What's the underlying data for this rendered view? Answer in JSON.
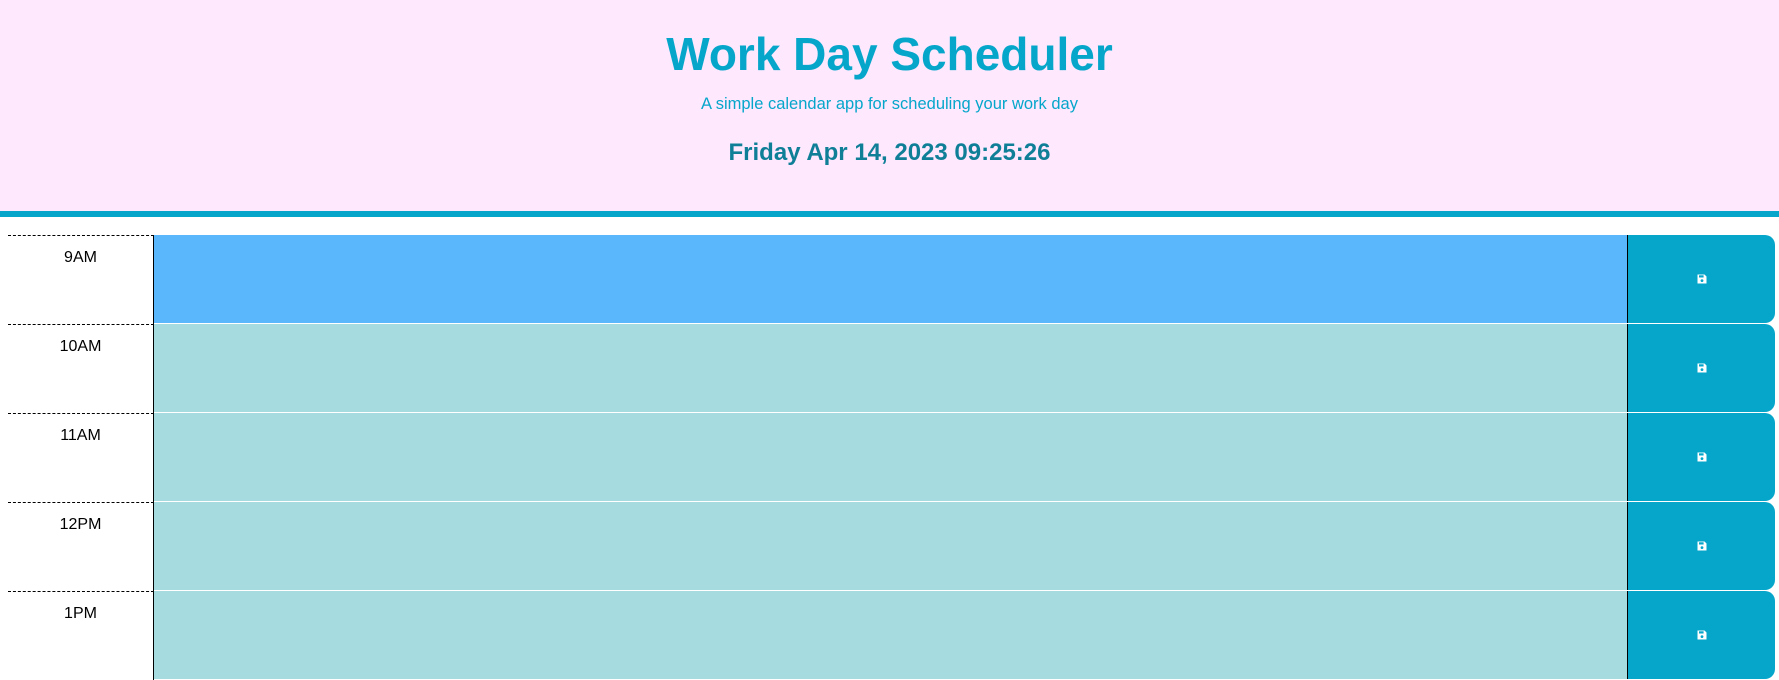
{
  "header": {
    "title": "Work Day Scheduler",
    "subtitle": "A simple calendar app for scheduling your work day",
    "current_datetime": "Friday Apr 14, 2023 09:25:26"
  },
  "colors": {
    "header_bg": "#fde8fd",
    "accent": "#06a6cb",
    "present": "#5ab7fb",
    "future": "#a6dbe0"
  },
  "time_blocks": [
    {
      "hour": "9AM",
      "text": "",
      "state": "present",
      "save_icon": "floppy-disk-icon"
    },
    {
      "hour": "10AM",
      "text": "",
      "state": "future",
      "save_icon": "floppy-disk-icon"
    },
    {
      "hour": "11AM",
      "text": "",
      "state": "future",
      "save_icon": "floppy-disk-icon"
    },
    {
      "hour": "12PM",
      "text": "",
      "state": "future",
      "save_icon": "floppy-disk-icon"
    },
    {
      "hour": "1PM",
      "text": "",
      "state": "future",
      "save_icon": "floppy-disk-icon"
    }
  ]
}
